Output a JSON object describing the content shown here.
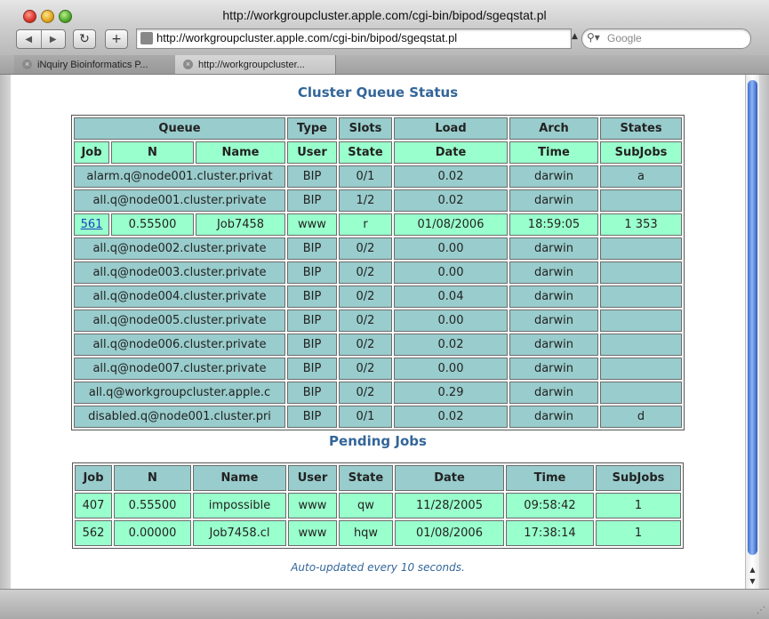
{
  "window": {
    "title": "http://workgroupcluster.apple.com/cgi-bin/bipod/sgeqstat.pl"
  },
  "toolbar": {
    "back_glyph": "◀",
    "forward_glyph": "▶",
    "reload_glyph": "↻",
    "add_glyph": "+",
    "address": "http://workgroupcluster.apple.com/cgi-bin/bipod/sgeqstat.pl",
    "search_placeholder": "Google"
  },
  "tabs": [
    {
      "label": "iNquiry Bioinformatics P..."
    },
    {
      "label": "http://workgroupcluster..."
    }
  ],
  "page": {
    "queue_title": "Cluster Queue Status",
    "pending_title": "Pending Jobs",
    "auto_update": "Auto-updated every 10 seconds."
  },
  "queue_table": {
    "header1": {
      "queue": "Queue",
      "type": "Type",
      "slots": "Slots",
      "load": "Load",
      "arch": "Arch",
      "states": "States"
    },
    "header2": {
      "job": "Job",
      "n": "N",
      "name": "Name",
      "user": "User",
      "state": "State",
      "date": "Date",
      "time": "Time",
      "subjobs": "SubJobs"
    },
    "rows": [
      {
        "queue": "alarm.q@node001.cluster.privat",
        "type": "BIP",
        "slots": "0/1",
        "load": "0.02",
        "arch": "darwin",
        "states": "a"
      },
      {
        "queue": "all.q@node001.cluster.private",
        "type": "BIP",
        "slots": "1/2",
        "load": "0.02",
        "arch": "darwin",
        "states": ""
      },
      {
        "job": "561",
        "n": "0.55500",
        "name": "Job7458",
        "user": "www",
        "state": "r",
        "date": "01/08/2006",
        "time": "18:59:05",
        "subjobs": "1 353"
      },
      {
        "queue": "all.q@node002.cluster.private",
        "type": "BIP",
        "slots": "0/2",
        "load": "0.00",
        "arch": "darwin",
        "states": ""
      },
      {
        "queue": "all.q@node003.cluster.private",
        "type": "BIP",
        "slots": "0/2",
        "load": "0.00",
        "arch": "darwin",
        "states": ""
      },
      {
        "queue": "all.q@node004.cluster.private",
        "type": "BIP",
        "slots": "0/2",
        "load": "0.04",
        "arch": "darwin",
        "states": ""
      },
      {
        "queue": "all.q@node005.cluster.private",
        "type": "BIP",
        "slots": "0/2",
        "load": "0.00",
        "arch": "darwin",
        "states": ""
      },
      {
        "queue": "all.q@node006.cluster.private",
        "type": "BIP",
        "slots": "0/2",
        "load": "0.02",
        "arch": "darwin",
        "states": ""
      },
      {
        "queue": "all.q@node007.cluster.private",
        "type": "BIP",
        "slots": "0/2",
        "load": "0.00",
        "arch": "darwin",
        "states": ""
      },
      {
        "queue": "all.q@workgroupcluster.apple.c",
        "type": "BIP",
        "slots": "0/2",
        "load": "0.29",
        "arch": "darwin",
        "states": ""
      },
      {
        "queue": "disabled.q@node001.cluster.pri",
        "type": "BIP",
        "slots": "0/1",
        "load": "0.02",
        "arch": "darwin",
        "states": "d"
      }
    ]
  },
  "pending_table": {
    "header": {
      "job": "Job",
      "n": "N",
      "name": "Name",
      "user": "User",
      "state": "State",
      "date": "Date",
      "time": "Time",
      "subjobs": "SubJobs"
    },
    "rows": [
      {
        "job": "407",
        "n": "0.55500",
        "name": "impossible",
        "user": "www",
        "state": "qw",
        "date": "11/28/2005",
        "time": "09:58:42",
        "subjobs": "1"
      },
      {
        "job": "562",
        "n": "0.00000",
        "name": "Job7458.cl",
        "user": "www",
        "state": "hqw",
        "date": "01/08/2006",
        "time": "17:38:14",
        "subjobs": "1"
      }
    ]
  },
  "colors": {
    "header_teal": "#99cccc",
    "header_green": "#99ffcc",
    "title_blue": "#336699"
  }
}
